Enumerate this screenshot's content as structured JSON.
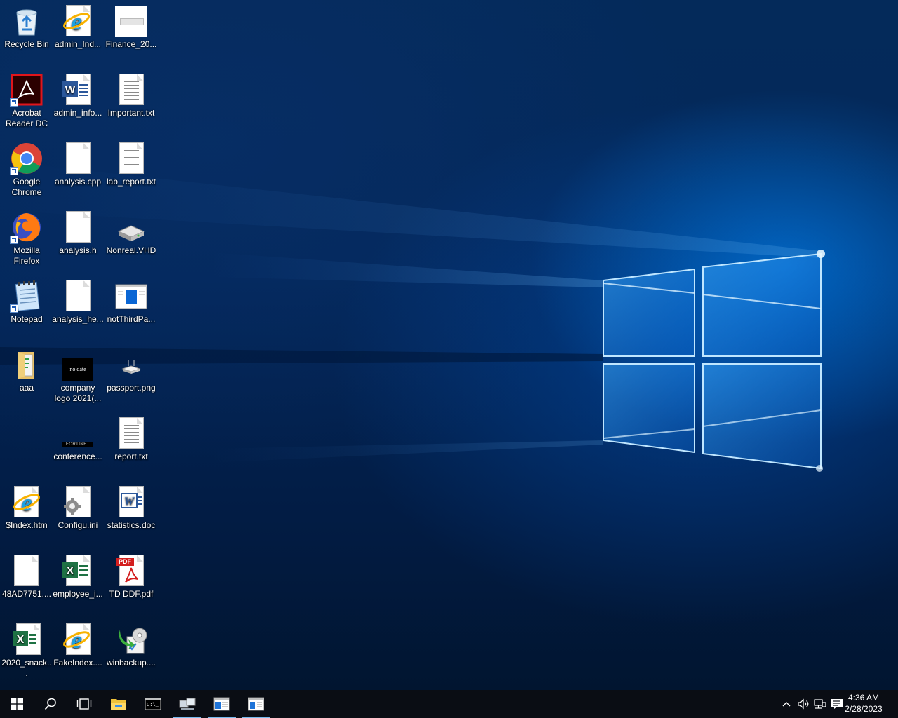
{
  "desktop": {
    "icons": [
      {
        "label": "Recycle Bin",
        "icon": "recycle-bin-icon"
      },
      {
        "label": "admin_Ind...",
        "icon": "internet-explorer-icon"
      },
      {
        "label": "Finance_20...",
        "icon": "image-thumbnail-icon"
      },
      {
        "label": "Acrobat Reader DC",
        "icon": "acrobat-reader-icon"
      },
      {
        "label": "admin_info...",
        "icon": "word-document-icon"
      },
      {
        "label": "Important.txt",
        "icon": "text-file-icon"
      },
      {
        "label": "Google Chrome",
        "icon": "chrome-icon"
      },
      {
        "label": "analysis.cpp",
        "icon": "blank-file-icon"
      },
      {
        "label": "lab_report.txt",
        "icon": "text-file-icon"
      },
      {
        "label": "Mozilla Firefox",
        "icon": "firefox-icon"
      },
      {
        "label": "analysis.h",
        "icon": "blank-file-icon"
      },
      {
        "label": "Nonreal.VHD",
        "icon": "virtual-disk-icon"
      },
      {
        "label": "Notepad",
        "icon": "notepad-icon"
      },
      {
        "label": "analysis_he...",
        "icon": "blank-file-icon"
      },
      {
        "label": "notThirdPa...",
        "icon": "window-thumbnail-icon"
      },
      {
        "label": "aaa",
        "icon": "folder-icon"
      },
      {
        "label": "company logo 2021(...",
        "icon": "logo-thumbnail-icon",
        "thumb_text": "no date"
      },
      {
        "label": "passport.png",
        "icon": "image-thumbnail-icon"
      },
      {
        "label": "conference...",
        "icon": "fortinet-logo-icon",
        "thumb_text": "FORTINET"
      },
      {
        "label": "report.txt",
        "icon": "text-file-icon"
      },
      {
        "label": "$Index.htm",
        "icon": "internet-explorer-icon"
      },
      {
        "label": "Configu.ini",
        "icon": "settings-file-icon"
      },
      {
        "label": "statistics.doc",
        "icon": "word-document-icon"
      },
      {
        "label": "48AD7751....",
        "icon": "blank-file-icon"
      },
      {
        "label": "employee_i...",
        "icon": "excel-icon"
      },
      {
        "label": "TD DDF.pdf",
        "icon": "pdf-icon",
        "badge": "PDF"
      },
      {
        "label": "2020_snack...",
        "icon": "excel-icon"
      },
      {
        "label": "FakeIndex....",
        "icon": "internet-explorer-icon"
      },
      {
        "label": "winbackup....",
        "icon": "backup-icon"
      }
    ]
  },
  "taskbar": {
    "clock": {
      "time": "4:36 AM",
      "date": "2/28/2023"
    },
    "accent_color": "#76b9ed"
  }
}
